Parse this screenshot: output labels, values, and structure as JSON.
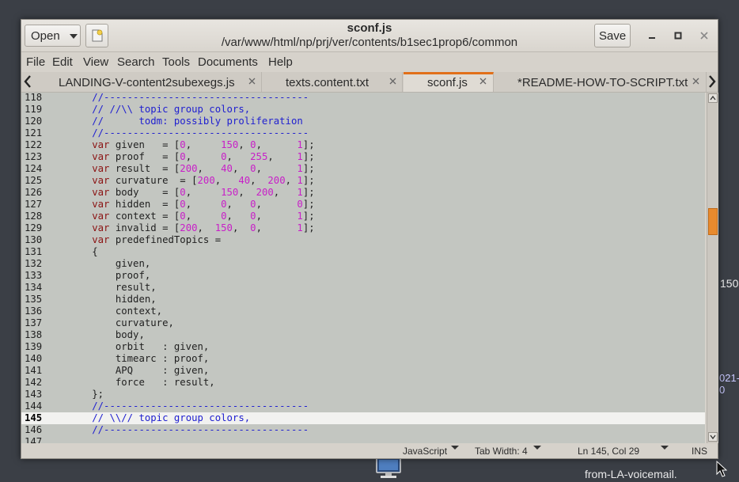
{
  "window": {
    "file_name": "sconf.js",
    "file_path": "/var/www/html/np/prj/ver/contents/b1sec1prop6/common",
    "open_label": "Open",
    "save_label": "Save"
  },
  "menu": [
    "File",
    "Edit",
    "View",
    "Search",
    "Tools",
    "Documents",
    "Help"
  ],
  "tabs": [
    {
      "label": "LANDING-V-content2subexegs.js",
      "active": false
    },
    {
      "label": "texts.content.txt",
      "active": false
    },
    {
      "label": "sconf.js",
      "active": true
    },
    {
      "label": "*README-HOW-TO-SCRIPT.txt",
      "active": false
    }
  ],
  "editor": {
    "current_line": 145,
    "lines": [
      {
        "n": "118",
        "code": "        //-----------------------------------"
      },
      {
        "n": "119",
        "code": "        // //\\\\ topic group colors,"
      },
      {
        "n": "120",
        "code": "        //      todm: possibly proliferation"
      },
      {
        "n": "121",
        "code": "        //-----------------------------------"
      },
      {
        "n": "122",
        "code": "        var given   = [0,     150, 0,      1];"
      },
      {
        "n": "123",
        "code": "        var proof   = [0,     0,   255,    1];"
      },
      {
        "n": "124",
        "code": "        var result  = [200,   40,  0,      1];"
      },
      {
        "n": "125",
        "code": "        var curvature  = [200,   40,  200, 1];"
      },
      {
        "n": "126",
        "code": "        var body    = [0,     150,  200,   1];"
      },
      {
        "n": "127",
        "code": "        var hidden  = [0,     0,   0,      0];"
      },
      {
        "n": "128",
        "code": "        var context = [0,     0,   0,      1];"
      },
      {
        "n": "129",
        "code": "        var invalid = [200,  150,  0,      1];"
      },
      {
        "n": "130",
        "code": "        var predefinedTopics ="
      },
      {
        "n": "131",
        "code": "        {"
      },
      {
        "n": "132",
        "code": "            given,"
      },
      {
        "n": "133",
        "code": "            proof,"
      },
      {
        "n": "134",
        "code": "            result,"
      },
      {
        "n": "135",
        "code": "            hidden,"
      },
      {
        "n": "136",
        "code": "            context,"
      },
      {
        "n": "137",
        "code": "            curvature,"
      },
      {
        "n": "138",
        "code": "            body,"
      },
      {
        "n": "139",
        "code": "            orbit   : given,"
      },
      {
        "n": "140",
        "code": "            timearc : proof,"
      },
      {
        "n": "141",
        "code": "            APQ     : given,"
      },
      {
        "n": "142",
        "code": "            force   : result,"
      },
      {
        "n": "143",
        "code": "        };"
      },
      {
        "n": "144",
        "code": "        //-----------------------------------"
      },
      {
        "n": "145",
        "code": "        // \\\\// topic group colors,"
      },
      {
        "n": "146",
        "code": "        //-----------------------------------"
      },
      {
        "n": "147",
        "code": ""
      }
    ]
  },
  "status": {
    "language": "JavaScript",
    "tab_width": "Tab Width: 4",
    "position": "Ln 145, Col 29",
    "mode": "INS"
  },
  "desktop": {
    "label_bottom": "from-LA-voicemail.",
    "label_right_1": "150",
    "label_right_2": "021-0"
  },
  "colors": {
    "active_tab_accent": "#e1701a",
    "keyword": "#8b1313",
    "number": "#c81ec8",
    "comment": "#2020d0",
    "editor_bg": "#c3c6c1",
    "current_line_bg": "#f2f2f0"
  },
  "icons": [
    "new-document-icon",
    "minimize-icon",
    "maximize-icon",
    "close-icon",
    "tab-close-icon",
    "scroll-left-icon",
    "scroll-right-icon",
    "scroll-up-icon",
    "scroll-down-icon",
    "computer-icon",
    "mouse-pointer-icon"
  ]
}
